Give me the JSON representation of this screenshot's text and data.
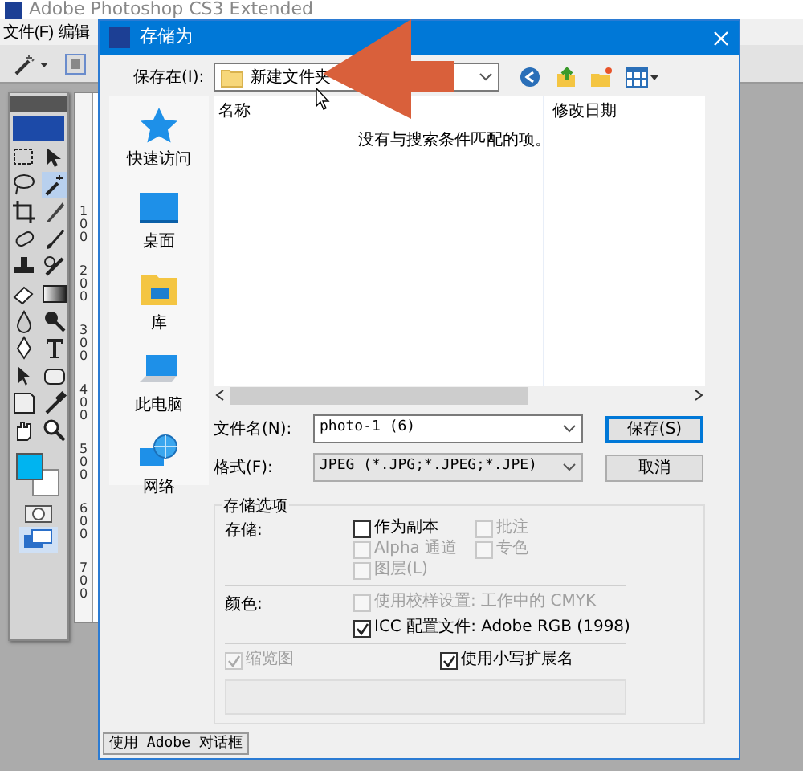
{
  "app": {
    "title": "Adobe Photoshop CS3 Extended",
    "menu": [
      "文件(F)",
      "编辑"
    ],
    "ruler_labels": [
      "100",
      "200",
      "300",
      "400",
      "500",
      "600",
      "700"
    ]
  },
  "dialog": {
    "title": "存储为",
    "save_in": {
      "label": "保存在(I):",
      "value": "新建文件夹"
    },
    "places": [
      {
        "label": "快速访问",
        "kind": "star"
      },
      {
        "label": "桌面",
        "kind": "desktop"
      },
      {
        "label": "库",
        "kind": "library"
      },
      {
        "label": "此电脑",
        "kind": "computer"
      },
      {
        "label": "网络",
        "kind": "network"
      }
    ],
    "columns": [
      "名称",
      "修改日期"
    ],
    "empty_message": "没有与搜索条件匹配的项。",
    "file_name": {
      "label": "文件名(N):",
      "value": "photo-1 (6)"
    },
    "format": {
      "label": "格式(F):",
      "value": "JPEG (*.JPG;*.JPEG;*.JPE)"
    },
    "buttons": [
      {
        "label": "保存(S)",
        "kind": "default"
      },
      {
        "label": "取消",
        "kind": "normal"
      }
    ],
    "options": {
      "legend": "存储选项",
      "save_label": "存储:",
      "save_checks": [
        {
          "label": "作为副本",
          "checked": false,
          "disabled": false
        },
        {
          "label": "批注",
          "checked": false,
          "disabled": true
        },
        {
          "label": "Alpha 通道",
          "checked": false,
          "disabled": true
        },
        {
          "label": "专色",
          "checked": false,
          "disabled": true
        },
        {
          "label": "图层(L)",
          "checked": false,
          "disabled": true
        }
      ],
      "color_label": "颜色:",
      "color_checks": [
        {
          "label": "使用校样设置: 工作中的 CMYK",
          "checked": false,
          "disabled": true
        },
        {
          "label": "ICC 配置文件: Adobe RGB (1998)",
          "checked": true,
          "disabled": false
        }
      ],
      "thumbnail": {
        "label": "缩览图",
        "checked": true,
        "disabled": true
      },
      "lowercase": {
        "label": "使用小写扩展名",
        "checked": true,
        "disabled": false
      }
    },
    "adobe_dialog_button": "使用 Adobe 对话框"
  }
}
